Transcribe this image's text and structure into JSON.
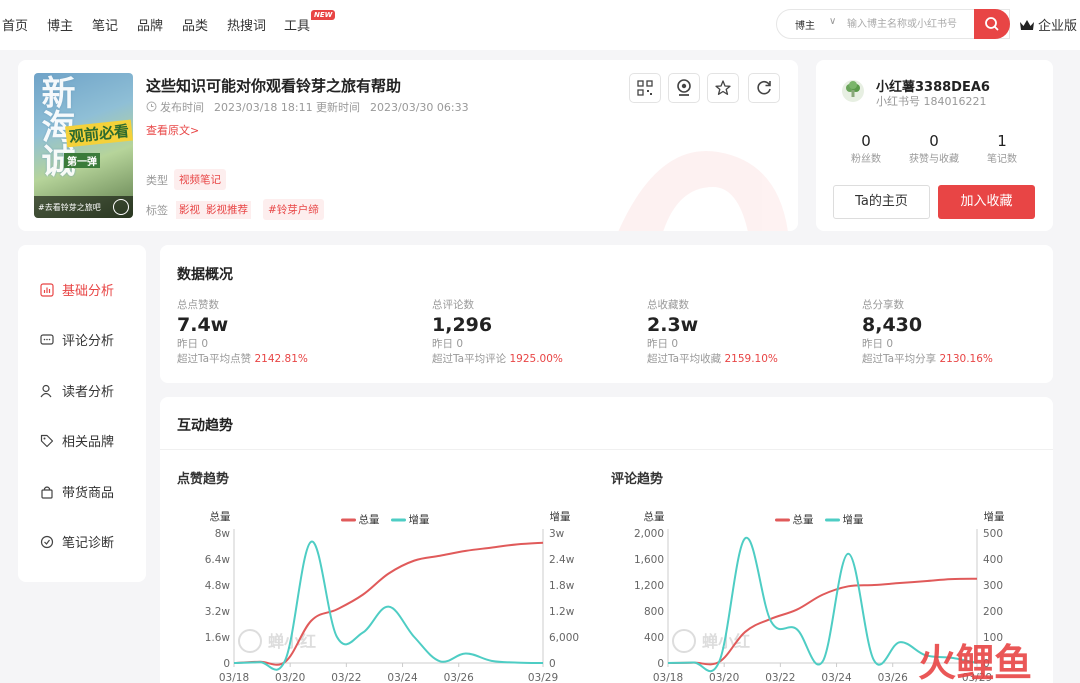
{
  "nav": {
    "items": [
      "首页",
      "博主",
      "笔记",
      "品牌",
      "品类",
      "热搜词",
      "工具"
    ],
    "new_badge": "NEW",
    "search_type": "博主",
    "search_placeholder": "输入博主名称或小红书号",
    "enterprise": "企业版"
  },
  "note": {
    "title": "这些知识可能对你观看铃芽之旅有帮助",
    "publish_label": "发布时间",
    "publish_time": "2023/03/18 18:11",
    "update_label": "更新时间",
    "update_time": "2023/03/30 06:33",
    "view_original": "查看原文>",
    "type_label": "类型",
    "type_value": "视频笔记",
    "tags_label": "标签",
    "tags": [
      "影视",
      "影视推荐",
      "#铃芽户缔"
    ],
    "cover": {
      "big_text": "新海诚",
      "tag": "观前必看",
      "sub": "第一弹",
      "bottom": "#去看铃芽之旅吧"
    }
  },
  "author": {
    "name": "小红薯3388DEA6",
    "id_label": "小红书号",
    "id": "184016221",
    "stats": [
      {
        "value": "0",
        "label": "粉丝数"
      },
      {
        "value": "0",
        "label": "获赞与收藏"
      },
      {
        "value": "1",
        "label": "笔记数"
      }
    ],
    "home_btn": "Ta的主页",
    "fav_btn": "加入收藏"
  },
  "sidebar": {
    "items": [
      {
        "label": "基础分析",
        "icon": "bar-chart-icon",
        "active": true
      },
      {
        "label": "评论分析",
        "icon": "comment-icon",
        "active": false
      },
      {
        "label": "读者分析",
        "icon": "user-icon",
        "active": false
      },
      {
        "label": "相关品牌",
        "icon": "tag-icon",
        "active": false
      },
      {
        "label": "带货商品",
        "icon": "bag-icon",
        "active": false
      },
      {
        "label": "笔记诊断",
        "icon": "diagnosis-icon",
        "active": false
      }
    ]
  },
  "overview": {
    "title": "数据概况",
    "items": [
      {
        "label": "总点赞数",
        "value": "7.4w",
        "yesterday": "昨日 0",
        "compare": "超过Ta平均点赞",
        "pct": "2142.81%"
      },
      {
        "label": "总评论数",
        "value": "1,296",
        "yesterday": "昨日 0",
        "compare": "超过Ta平均评论",
        "pct": "1925.00%"
      },
      {
        "label": "总收藏数",
        "value": "2.3w",
        "yesterday": "昨日 0",
        "compare": "超过Ta平均收藏",
        "pct": "2159.10%"
      },
      {
        "label": "总分享数",
        "value": "8,430",
        "yesterday": "昨日 0",
        "compare": "超过Ta平均分享",
        "pct": "2130.16%"
      }
    ]
  },
  "trend": {
    "title": "互动趋势",
    "watermark": "蝉小红",
    "corner_brand": "火鲤鱼"
  },
  "colors": {
    "accent": "#e84545",
    "total": "#e05a5a",
    "incr": "#4ecdc4"
  },
  "chart_data": [
    {
      "type": "line",
      "title": "点赞趋势",
      "ylabel_left": "总量",
      "ylabel_right": "增量",
      "legend": [
        "总量",
        "增量"
      ],
      "legend_position": "top-center",
      "x_ticks": [
        "03/18",
        "03/20",
        "03/22",
        "03/24",
        "03/26",
        "03/29"
      ],
      "y_left_ticks": [
        "0",
        "1.6w",
        "3.2w",
        "4.8w",
        "6.4w",
        "8w"
      ],
      "y_right_ticks": [
        "0",
        "6,000",
        "1.2w",
        "1.8w",
        "2.4w",
        "3w"
      ],
      "ylim_left": [
        0,
        80000
      ],
      "ylim_right": [
        0,
        30000
      ],
      "x_days": [
        0,
        1,
        2,
        3,
        4,
        5,
        6,
        7,
        8,
        9,
        10,
        11,
        12
      ],
      "series": [
        {
          "name": "总量",
          "values": [
            0,
            800,
            900,
            26000,
            33000,
            42000,
            55000,
            63000,
            66000,
            69000,
            71000,
            73000,
            74000
          ]
        },
        {
          "name": "增量",
          "values": [
            0,
            200,
            800,
            28000,
            6000,
            7000,
            13000,
            6000,
            400,
            2200,
            500,
            100,
            0
          ]
        }
      ]
    },
    {
      "type": "line",
      "title": "评论趋势",
      "ylabel_left": "总量",
      "ylabel_right": "增量",
      "legend": [
        "总量",
        "增量"
      ],
      "legend_position": "top-center",
      "x_ticks": [
        "03/18",
        "03/20",
        "03/22",
        "03/24",
        "03/26",
        "03/29"
      ],
      "y_left_ticks": [
        "0",
        "400",
        "800",
        "1,200",
        "1,600",
        "2,000"
      ],
      "y_right_ticks": [
        "0",
        "100",
        "200",
        "300",
        "400",
        "500"
      ],
      "ylim_left": [
        0,
        2000
      ],
      "ylim_right": [
        0,
        500
      ],
      "x_days": [
        0,
        1,
        2,
        3,
        4,
        5,
        6,
        7,
        8,
        9,
        10,
        11,
        12
      ],
      "series": [
        {
          "name": "总量",
          "values": [
            0,
            5,
            20,
            480,
            680,
            820,
            1050,
            1180,
            1200,
            1230,
            1260,
            1290,
            1296
          ]
        },
        {
          "name": "增量",
          "values": [
            0,
            2,
            8,
            480,
            160,
            130,
            5,
            420,
            10,
            80,
            30,
            20,
            0
          ]
        }
      ]
    }
  ]
}
